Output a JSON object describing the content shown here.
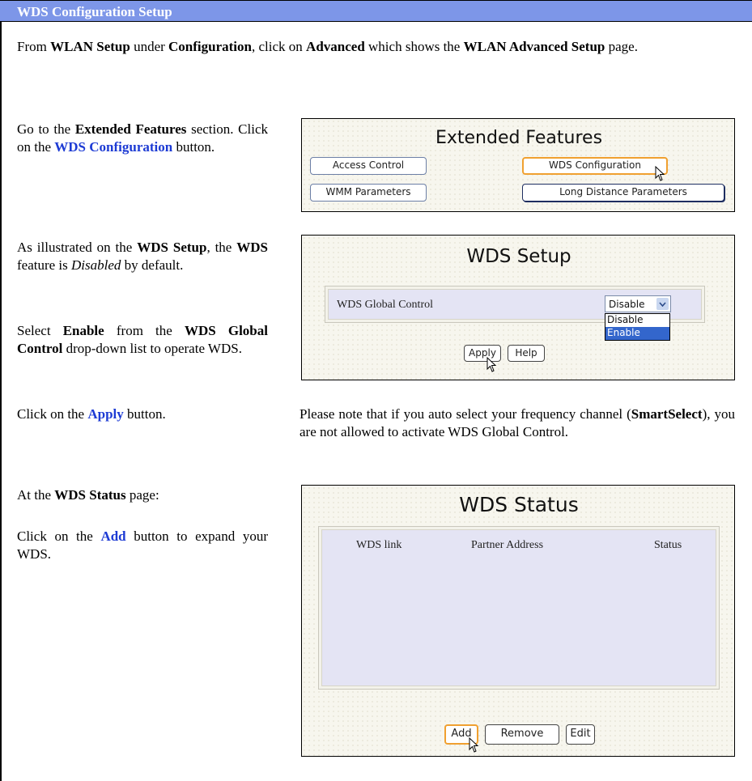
{
  "section_title": "WDS Configuration Setup",
  "intro": {
    "p1": "From ",
    "wlan_setup": "WLAN Setup",
    "p2": " under ",
    "configuration": "Configuration",
    "p3": ", click on ",
    "advanced": "Advanced",
    "p4": " which shows the ",
    "wlan_advanced_setup": "WLAN Advanced Setup",
    "p5": " page."
  },
  "step_extended": {
    "p1": "Go to the ",
    "extended_features": "Extended Features",
    "p2": " section. Click on the ",
    "wds_configuration": "WDS Configuration",
    "p3": " button."
  },
  "step_default": {
    "p1": "As illustrated on the ",
    "wds_setup": "WDS Setup",
    "p2": ", the ",
    "wds": "WDS",
    "p3": " feature is ",
    "disabled": "Disabled",
    "p4": " by default."
  },
  "step_enable": {
    "p1": "Select ",
    "enable": "Enable",
    "p2": " from the ",
    "wds_global_control": "WDS Global Control",
    "p3": " drop-down list to operate WDS."
  },
  "step_apply": {
    "p1": "Click on the ",
    "apply": "Apply",
    "p2": " button."
  },
  "note": {
    "p1": "Please note that if you auto select your frequency channel (",
    "smartselect": "SmartSelect",
    "p2": "), you are not allowed to activate WDS Global Control."
  },
  "step_status": {
    "p1": "At the ",
    "wds_status": "WDS Status",
    "p2": " page:"
  },
  "step_add": {
    "p1": "Click on the ",
    "add": "Add",
    "p2": " button to expand your WDS."
  },
  "extended_features_panel": {
    "heading": "Extended Features",
    "buttons": {
      "access_control": "Access Control",
      "wds_configuration": "WDS Configuration",
      "wmm_parameters": "WMM Parameters",
      "long_distance": "Long Distance Parameters"
    }
  },
  "wds_setup_panel": {
    "heading": "WDS Setup",
    "global_control_label": "WDS Global Control",
    "select_value": "Disable",
    "options": [
      "Disable",
      "Enable"
    ],
    "buttons": {
      "apply": "Apply",
      "help": "Help"
    }
  },
  "wds_status_panel": {
    "heading": "WDS Status",
    "columns": [
      "WDS link",
      "Partner Address",
      "Status"
    ],
    "buttons": {
      "add": "Add",
      "remove": "Remove",
      "edit": "Edit"
    }
  },
  "colors": {
    "title_bar": "#7d96e8",
    "link_blue": "#1d3bd4",
    "dropdown_highlight": "#3366cc",
    "table_fill": "#e4e4f4"
  },
  "icons": [
    "mouse-cursor-icon",
    "dropdown-arrow-icon"
  ]
}
